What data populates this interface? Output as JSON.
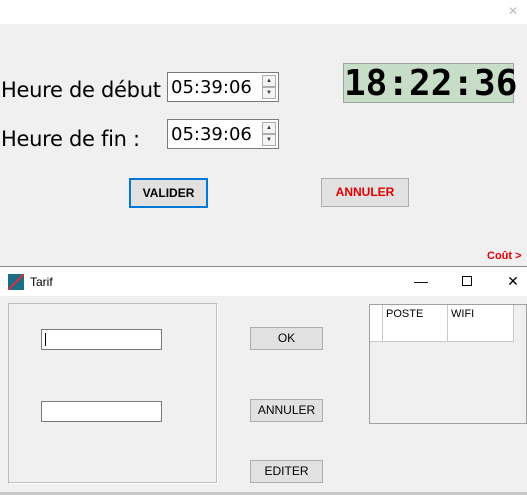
{
  "main_form": {
    "start_label": "Heure de début :",
    "start_value": "05:39:06",
    "end_label": "Heure de fin :",
    "end_value": "05:39:06",
    "clock": "18:22:36",
    "clock_color": "#c7ddc7",
    "validate_label": "VALIDER",
    "cancel_label": "ANNULER",
    "cancel_color": "#e00000",
    "cost_link": "Coût >"
  },
  "dialog": {
    "title": "Tarif",
    "minimize_glyph": "—",
    "close_glyph": "✕",
    "field1_value": "",
    "field2_value": "",
    "ok_label": "OK",
    "cancel_label": "ANNULER",
    "edit_label": "EDITER",
    "grid": {
      "columns": [
        "POSTE",
        "WIFI"
      ]
    }
  }
}
